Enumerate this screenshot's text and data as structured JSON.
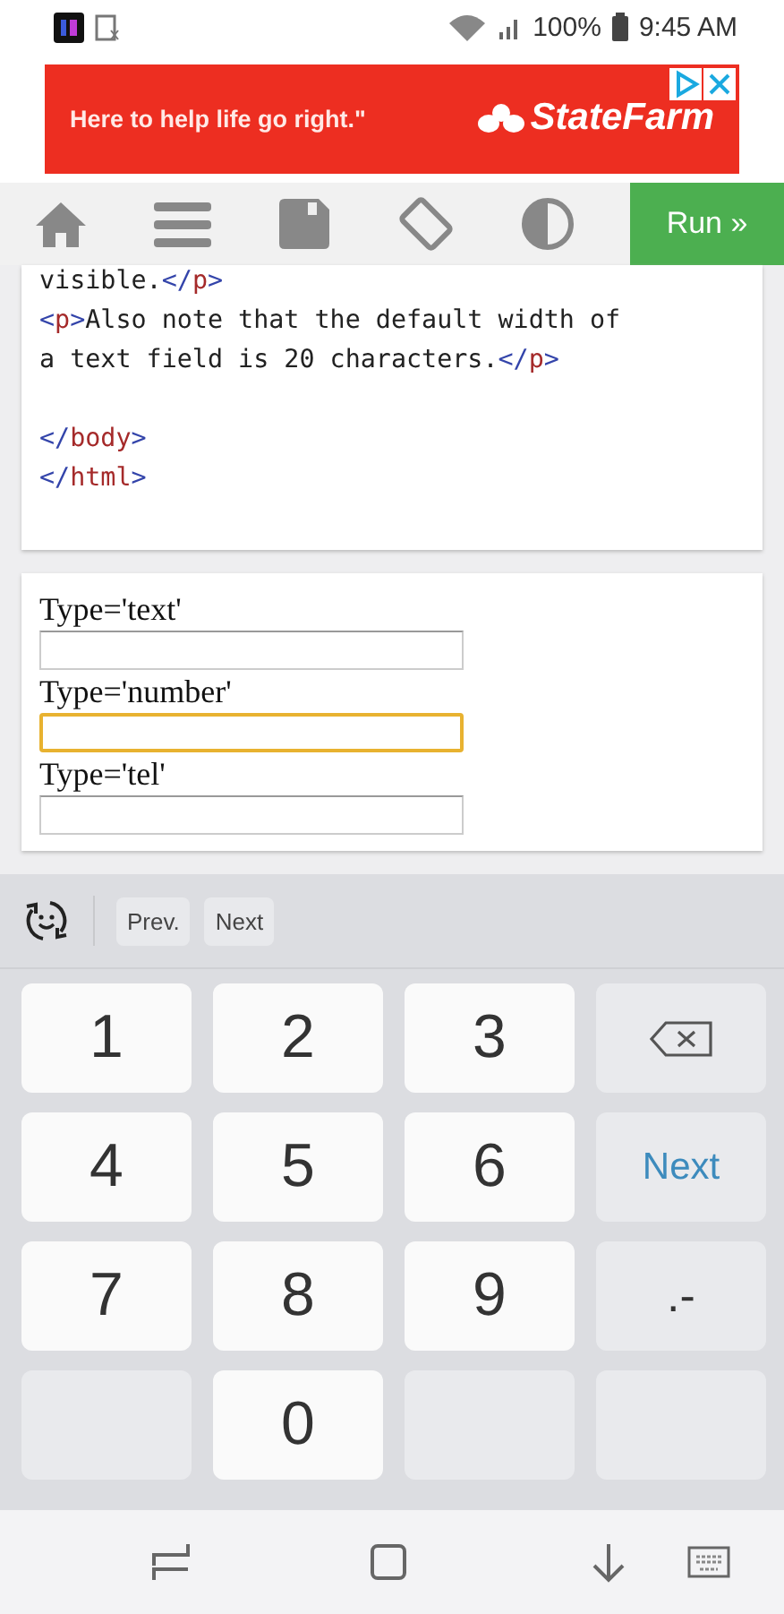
{
  "status_bar": {
    "battery": "100%",
    "time": "9:45 AM"
  },
  "ad": {
    "slogan": "Here to help life go right.\"",
    "brand": "StateFarm"
  },
  "toolbar": {
    "run_label": "Run »"
  },
  "code": {
    "lines": [
      {
        "kind": "code",
        "segments": [
          {
            "kind": "text",
            "text": "visible."
          },
          {
            "kind": "bracket",
            "text": "</"
          },
          {
            "kind": "tag",
            "text": "p"
          },
          {
            "kind": "bracket",
            "text": ">"
          }
        ]
      },
      {
        "kind": "code",
        "segments": [
          {
            "kind": "bracket",
            "text": "<"
          },
          {
            "kind": "tag",
            "text": "p"
          },
          {
            "kind": "bracket",
            "text": ">"
          },
          {
            "kind": "text",
            "text": "Also note that the default width of"
          }
        ]
      },
      {
        "kind": "code",
        "segments": [
          {
            "kind": "text",
            "text": "a text field is 20 characters."
          },
          {
            "kind": "bracket",
            "text": "</"
          },
          {
            "kind": "tag",
            "text": "p"
          },
          {
            "kind": "bracket",
            "text": ">"
          }
        ]
      },
      {
        "kind": "blank"
      },
      {
        "kind": "code",
        "segments": [
          {
            "kind": "bracket",
            "text": "</"
          },
          {
            "kind": "tag",
            "text": "body"
          },
          {
            "kind": "bracket",
            "text": ">"
          }
        ]
      },
      {
        "kind": "code",
        "segments": [
          {
            "kind": "bracket",
            "text": "</"
          },
          {
            "kind": "tag",
            "text": "html"
          },
          {
            "kind": "bracket",
            "text": ">"
          }
        ]
      }
    ]
  },
  "result": {
    "fields": [
      {
        "label": "Type='text'",
        "focused": false
      },
      {
        "label": "Type='number'",
        "focused": true
      },
      {
        "label": "Type='tel'",
        "focused": false
      }
    ]
  },
  "keyboard": {
    "toolbar": [
      "Prev.",
      "Next"
    ],
    "rows": [
      [
        {
          "kind": "digit",
          "text": "1"
        },
        {
          "kind": "digit",
          "text": "2"
        },
        {
          "kind": "digit",
          "text": "3"
        },
        {
          "kind": "backspace"
        }
      ],
      [
        {
          "kind": "digit",
          "text": "4"
        },
        {
          "kind": "digit",
          "text": "5"
        },
        {
          "kind": "digit",
          "text": "6"
        },
        {
          "kind": "action",
          "text": "Next"
        }
      ],
      [
        {
          "kind": "digit",
          "text": "7"
        },
        {
          "kind": "digit",
          "text": "8"
        },
        {
          "kind": "digit",
          "text": "9"
        },
        {
          "kind": "symbol",
          "text": ".-"
        }
      ],
      [
        {
          "kind": "empty"
        },
        {
          "kind": "digit",
          "text": "0"
        },
        {
          "kind": "empty"
        },
        {
          "kind": "empty"
        }
      ]
    ]
  }
}
